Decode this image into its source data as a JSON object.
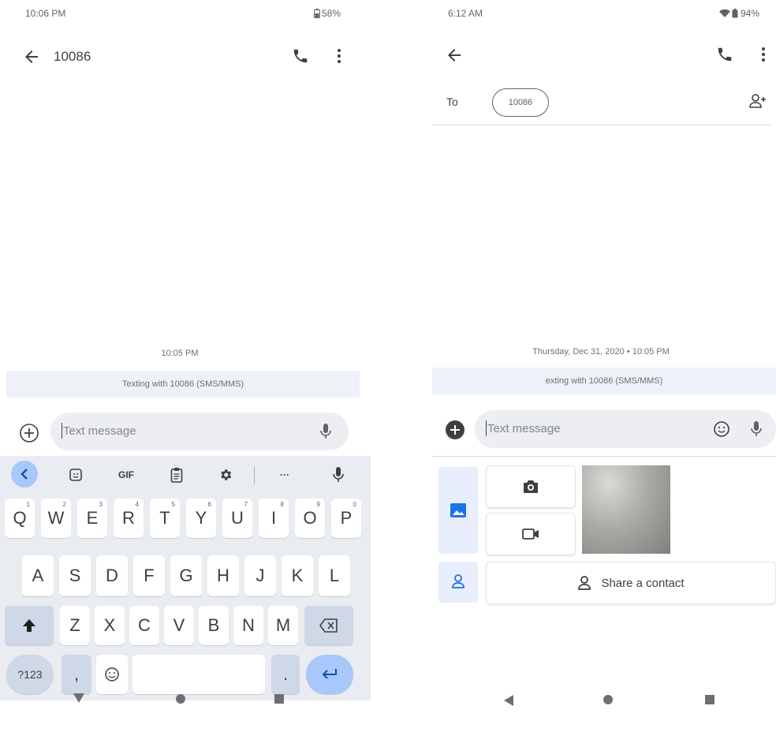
{
  "left": {
    "status": {
      "time": "10:06 PM",
      "battery": "58%"
    },
    "header": {
      "title": "10086"
    },
    "conversation": {
      "timestamp": "10:05 PM",
      "banner": "Texting with 10086 (SMS/MMS)"
    },
    "compose": {
      "placeholder": "Text message"
    },
    "keyboard": {
      "toolbar": {
        "gif_label": "GIF",
        "more_label": "···"
      },
      "row1": [
        {
          "label": "Q",
          "hint": "1"
        },
        {
          "label": "W",
          "hint": "2"
        },
        {
          "label": "E",
          "hint": "3"
        },
        {
          "label": "R",
          "hint": "4"
        },
        {
          "label": "T",
          "hint": "5"
        },
        {
          "label": "Y",
          "hint": "6"
        },
        {
          "label": "U",
          "hint": "7"
        },
        {
          "label": "I",
          "hint": "8"
        },
        {
          "label": "O",
          "hint": "9"
        },
        {
          "label": "P",
          "hint": "0"
        }
      ],
      "row2": [
        "A",
        "S",
        "D",
        "F",
        "G",
        "H",
        "J",
        "K",
        "L"
      ],
      "row3": [
        "Z",
        "X",
        "C",
        "V",
        "B",
        "N",
        "M"
      ],
      "bottom": {
        "symbols_label": "?123",
        "comma": ",",
        "period": "."
      }
    }
  },
  "right": {
    "status": {
      "time": "6:12 AM",
      "battery": "94%"
    },
    "to": {
      "label": "To",
      "chip": "10086"
    },
    "conversation": {
      "timestamp": "Thursday, Dec 31, 2020 • 10:05 PM",
      "banner": "exting with 10086 (SMS/MMS)"
    },
    "compose": {
      "placeholder": "Text message"
    },
    "attachments": {
      "share_contact_label": "Share a contact"
    }
  },
  "colors": {
    "accent_blue": "#1a73e8",
    "key_bg": "#ffffff",
    "keyboard_bg": "#e9ecf0",
    "enter_key": "#a8c7fa",
    "banner_bg": "#eef1f7"
  }
}
